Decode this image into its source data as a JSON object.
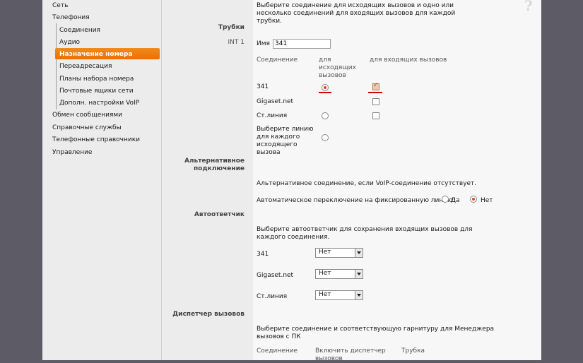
{
  "nav": {
    "items": [
      {
        "label": "Сеть"
      },
      {
        "label": "Телефония"
      },
      {
        "label": "Обмен сообщениями"
      },
      {
        "label": "Справочные службы"
      },
      {
        "label": "Телефонные справочники"
      },
      {
        "label": "Управление"
      }
    ],
    "sub_items": [
      {
        "label": "Соединения"
      },
      {
        "label": "Аудио"
      },
      {
        "label": "Назначение номера",
        "active": true
      },
      {
        "label": "Переадресация"
      },
      {
        "label": "Планы набора номера"
      },
      {
        "label": "Почтовые ящики сети"
      },
      {
        "label": "Дополн. настройки VoIP"
      }
    ]
  },
  "help_icon": "question-icon",
  "intro": "Выберите соединение для исходящих вызовов и одно или несколько соединений для входящих вызовов для каждой трубки.",
  "handsets": {
    "section_label": "Трубки",
    "int_label": "INT 1",
    "name_label": "Имя",
    "name_value": "341",
    "col_connection": "Соединение",
    "col_outgoing": "для исходящих вызовов",
    "col_incoming": "для входящих вызовов",
    "rows": [
      {
        "label": "341",
        "outgoing": true,
        "incoming": true
      },
      {
        "label": "Gigaset.net",
        "outgoing": null,
        "incoming": false
      },
      {
        "label": "Ст.линия",
        "outgoing": false,
        "incoming": false
      },
      {
        "label": "Выберите линию для каждого исходящего вызова",
        "outgoing": false,
        "incoming": null
      }
    ]
  },
  "alt": {
    "section_label": "Альтернативное подключение",
    "desc": "Альтернативное соединение, если VoIP-соединение отсутствует.",
    "switch_label": "Автоматическое переключение на фиксированную линию:",
    "yes": "Да",
    "no": "Нет",
    "selected": "no"
  },
  "answering": {
    "section_label": "Автоответчик",
    "desc": "Выберите автоответчик для сохранения входящих вызовов для каждого соединения.",
    "rows": [
      {
        "label": "341",
        "value": "Нет"
      },
      {
        "label": "Gigaset.net",
        "value": "Нет"
      },
      {
        "label": "Ст.линия",
        "value": "Нет"
      }
    ]
  },
  "dispatcher": {
    "section_label": "Диспетчер вызовов",
    "desc": "Выберите соединение и соответствующую гарнитуру для Менеджера вызовов с ПК",
    "col_connection": "Соединение",
    "col_enable": "Включить диспетчер вызовов",
    "col_handset": "Трубка"
  },
  "colors": {
    "accent": "#e8700a",
    "mark": "#d40000"
  }
}
